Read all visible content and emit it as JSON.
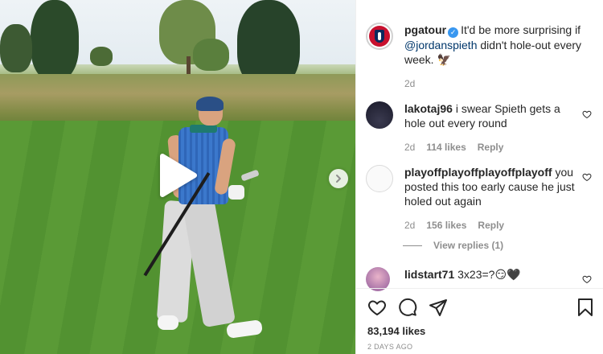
{
  "post": {
    "author": "pgatour",
    "caption_pre": "It'd be more surprising if ",
    "caption_mention": "@jordanspieth",
    "caption_post": " didn't hole-out every week. ",
    "caption_emoji": "🦅",
    "age": "2d"
  },
  "comments": [
    {
      "user": "lakotaj96",
      "text": "i swear Spieth gets a hole out every round",
      "age": "2d",
      "likes": "114 likes",
      "reply": "Reply"
    },
    {
      "user": "playoffplayoffplayoffplayoff",
      "text": "you posted this too early cause he just holed out again",
      "age": "2d",
      "likes": "156 likes",
      "reply": "Reply"
    },
    {
      "user": "lidstart71",
      "text": "3x23=?😏🖤"
    }
  ],
  "view_replies": "View replies (1)",
  "likes_count": "83,194 likes",
  "posted": "2 DAYS AGO",
  "icons": [
    "play-icon",
    "chevron-right-icon",
    "heart-icon",
    "comment-icon",
    "share-icon",
    "bookmark-icon",
    "verified-icon"
  ],
  "colors": {
    "verified": "#3897f0",
    "mention": "#00376b",
    "muted": "#8e8e8e",
    "pga_red": "#c8102e",
    "pga_blue": "#0a2a5e"
  }
}
